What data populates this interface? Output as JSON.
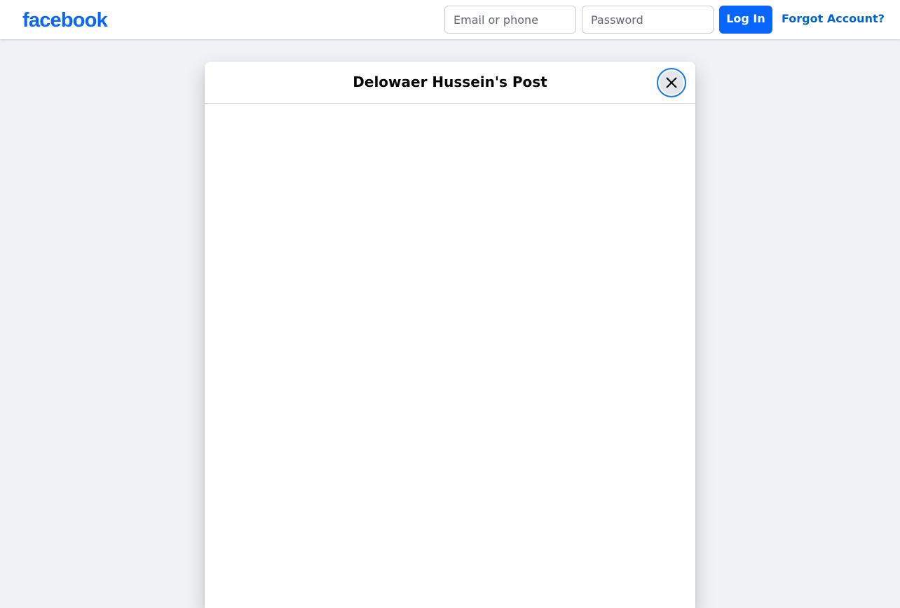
{
  "header": {
    "logo_text": "facebook",
    "email_placeholder": "Email or phone",
    "password_placeholder": "Password",
    "login_label": "Log In",
    "forgot_label": "Forgot Account?"
  },
  "modal": {
    "title": "Delowaer Hussein's Post",
    "close_icon": "close-icon"
  },
  "colors": {
    "brand_blue": "#0866ff",
    "link_blue": "#0064d1",
    "page_background": "#f0f2f5"
  }
}
